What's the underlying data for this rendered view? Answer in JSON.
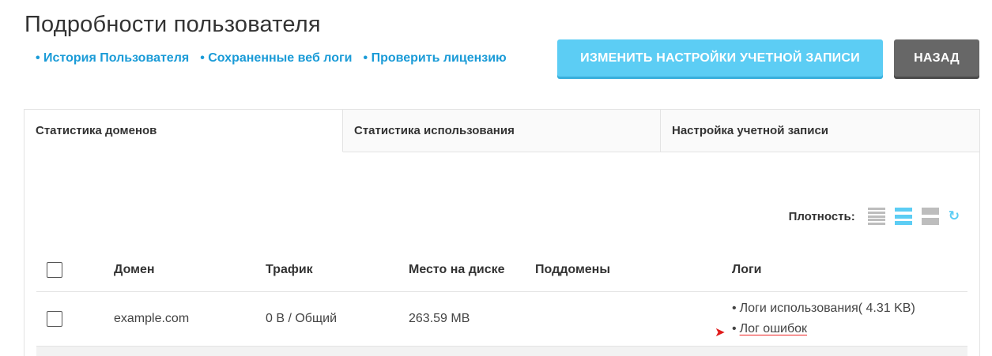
{
  "page": {
    "title": "Подробности пользователя"
  },
  "links": [
    {
      "label": "• История Пользователя"
    },
    {
      "label": "• Сохраненные веб логи"
    },
    {
      "label": "• Проверить лицензию"
    }
  ],
  "buttons": {
    "primary": "ИЗМЕНИТЬ НАСТРОЙКИ УЧЕТНОЙ ЗАПИСИ",
    "back": "НАЗАД"
  },
  "tabs": [
    {
      "label": "Статистика доменов",
      "active": true
    },
    {
      "label": "Статистика использования",
      "active": false
    },
    {
      "label": "Настройка учетной записи",
      "active": false
    }
  ],
  "density": {
    "label": "Плотность:",
    "selected": "normal"
  },
  "table": {
    "headers": {
      "domain": "Домен",
      "traffic": "Трафик",
      "disk": "Место на диске",
      "subdomains": "Поддомены",
      "logs": "Логи"
    },
    "rows": [
      {
        "domain": "example.com",
        "traffic": "0 B / Общий",
        "disk": "263.59 MB",
        "subdomains": "",
        "logs": {
          "usage": "Логи использования( 4.31 KB)",
          "errors": "Лог ошибок"
        }
      }
    ]
  },
  "colors": {
    "accent": "#5ccdf4",
    "link": "#1a9bd7",
    "back_button": "#676767",
    "marker": "#e01b1b"
  }
}
